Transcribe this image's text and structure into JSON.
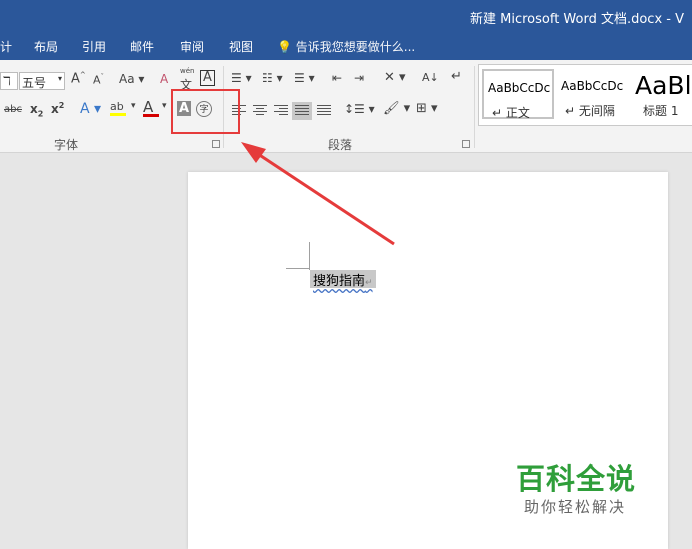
{
  "window": {
    "title": "新建 Microsoft Word 文档.docx - V"
  },
  "menu": {
    "tabs": [
      "计",
      "布局",
      "引用",
      "邮件",
      "审阅",
      "视图"
    ],
    "tell_me": "告诉我您想要做什么..."
  },
  "ribbon": {
    "font": {
      "font_name_partial": "ℸ",
      "font_size": "五号",
      "grow": "A",
      "shrink": "A",
      "change_case": "Aa",
      "clear_format": "A",
      "phonetic_top": "wén",
      "phonetic_bottom": "文",
      "border_char": "A",
      "strikethrough": "abc",
      "subscript": "x",
      "superscript": "x",
      "text_effects": "A",
      "highlight": "ab",
      "font_color": "A",
      "char_shading": "A",
      "enclose_char": "字",
      "group_label": "字体"
    },
    "paragraph": {
      "group_label": "段落",
      "sort": "A↓",
      "show_marks": "↵"
    },
    "styles": [
      {
        "sample": "AaBbCcDc",
        "name": "↵ 正文",
        "selected": true
      },
      {
        "sample": "AaBbCcDc",
        "name": "↵ 无间隔",
        "selected": false
      },
      {
        "sample": "AaBl",
        "name": "标题 1",
        "selected": false
      }
    ]
  },
  "document": {
    "text": "搜狗指南"
  },
  "watermark": {
    "title": "百科全说",
    "subtitle": "助你轻松解决"
  },
  "colors": {
    "accent": "#2b579a",
    "annotation_red": "#e53b3b",
    "watermark_green": "#2f9e3a"
  }
}
